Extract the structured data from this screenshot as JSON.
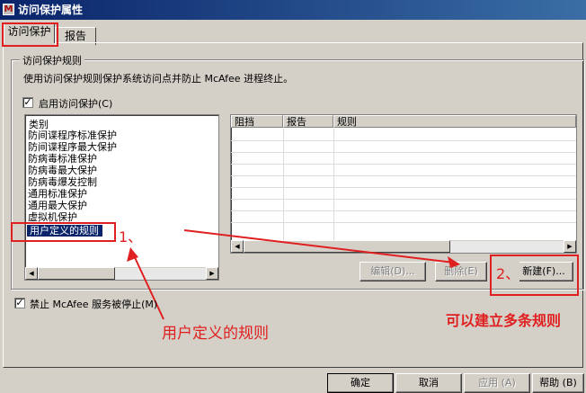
{
  "window": {
    "title": "访问保护属性"
  },
  "tabs": [
    {
      "label": "访问保护"
    },
    {
      "label": "报告"
    }
  ],
  "group": {
    "title": "访问保护规则"
  },
  "description": "使用访问保护规则保护系统访问点并防止 McAfee 进程终止。",
  "enable_checkbox": {
    "label": "启用访问保护(C)",
    "checked": "✓"
  },
  "category_list": {
    "header": "类别",
    "items": [
      "防间谍程序标准保护",
      "防间谍程序最大保护",
      "防病毒标准保护",
      "防病毒最大保护",
      "防病毒爆发控制",
      "通用标准保护",
      "通用最大保护",
      "虚拟机保护"
    ],
    "selected": "用户定义的规则"
  },
  "rules_table": {
    "columns": [
      "阻挡",
      "报告",
      "规则"
    ]
  },
  "buttons": {
    "edit": "编辑(D)...",
    "delete": "删除(E)",
    "new": "新建(F)...",
    "ok": "确定",
    "cancel": "取消",
    "apply": "应用 (A)",
    "help": "帮助 (B)"
  },
  "disable_stop_checkbox": {
    "label": "禁止 McAfee 服务被停止(M)",
    "checked": "✓"
  },
  "annotations": {
    "step1": "1、",
    "step2": "2、",
    "user_rules": "用户定义的规则",
    "multiple_rules": "可以建立多条规则"
  },
  "colors": {
    "annotation_red": "#e02020",
    "titlebar": "#0a246a",
    "selection": "#0a246a"
  }
}
